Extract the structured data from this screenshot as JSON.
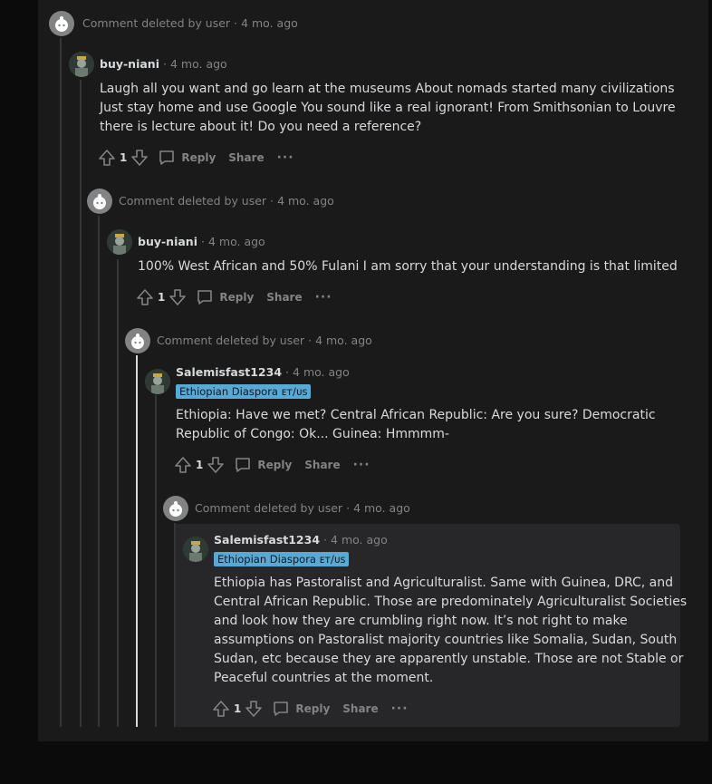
{
  "comments": [
    {
      "kind": "deleted",
      "text": "Comment deleted by user",
      "age": "4 mo. ago"
    },
    {
      "kind": "user",
      "author": "buy-niani",
      "age": "4 mo. ago",
      "lines": [
        "Laugh all you want and go learn at the museums About nomads started many civilizations",
        "Just stay home and use Google You sound like a real ignorant! From Smithsonian to Louvre",
        "there is lecture about it! Do you need a reference?"
      ],
      "score": "1",
      "reply": "Reply",
      "share": "Share",
      "more": "···"
    },
    {
      "kind": "deleted",
      "text": "Comment deleted by user",
      "age": "4 mo. ago"
    },
    {
      "kind": "user",
      "author": "buy-niani",
      "age": "4 mo. ago",
      "lines": [
        "100% West African and 50% Fulani I am sorry that your understanding is that limited"
      ],
      "score": "1",
      "reply": "Reply",
      "share": "Share",
      "more": "···"
    },
    {
      "kind": "deleted",
      "text": "Comment deleted by user",
      "age": "4 mo. ago"
    },
    {
      "kind": "user",
      "author": "Salemisfast1234",
      "age": "4 mo. ago",
      "flair": "Ethiopian Diaspora ᴇᴛ/ᴜs",
      "lines": [
        "Ethiopia: Have we met? Central African Republic: Are you sure? Democratic",
        "Republic of Congo: Ok... Guinea: Hmmmm-"
      ],
      "score": "1",
      "reply": "Reply",
      "share": "Share",
      "more": "···"
    },
    {
      "kind": "deleted",
      "text": "Comment deleted by user",
      "age": "4 mo. ago"
    },
    {
      "kind": "user",
      "author": "Salemisfast1234",
      "age": "4 mo. ago",
      "flair": "Ethiopian Diaspora ᴇᴛ/ᴜs",
      "lines": [
        "Ethiopia has Pastoralist and Agriculturalist. Same with Guinea, DRC, and",
        "Central African Republic. Those are predominately Agriculturalist Societies",
        "and look how they are crumbling right now. It’s not right to make",
        "assumptions on Pastoralist majority countries like Somalia, Sudan, South",
        "Sudan, etc because they are apparently unstable. Those are not Stable or",
        "Peaceful countries at the moment."
      ],
      "score": "1",
      "reply": "Reply",
      "share": "Share",
      "more": "···"
    }
  ],
  "colors": {
    "background": "#1a1a1b",
    "text": "#d7dadc",
    "muted": "#818384",
    "flair": "#5aa9d4",
    "highlight": "#272729"
  }
}
